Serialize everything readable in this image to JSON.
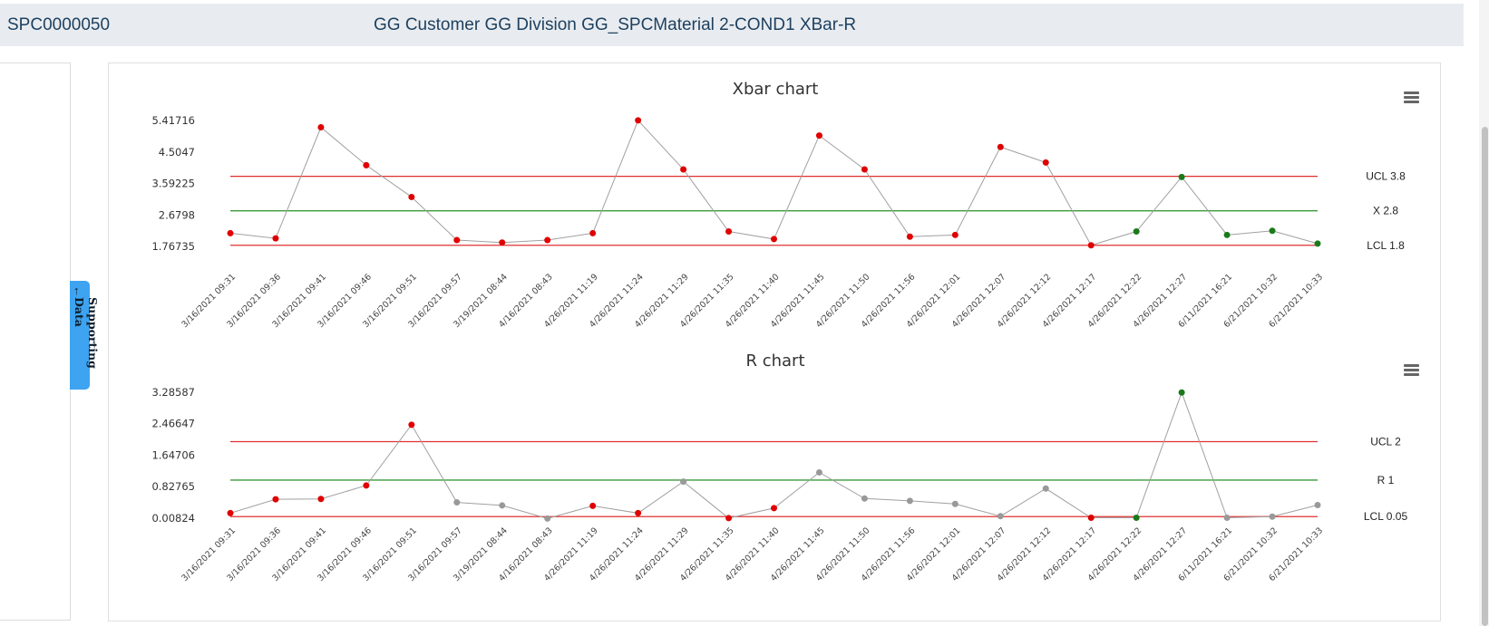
{
  "header": {
    "code": "SPC0000050",
    "title": "GG Customer GG Division GG_SPCMaterial 2-COND1 XBar-R"
  },
  "side_tab": {
    "icon": "arrow-icon",
    "label": "Supporting Data"
  },
  "colors": {
    "limit": "#e03030",
    "center": "#3c9a3c",
    "series_line": "#a0a0a0",
    "point_out": "#e00000",
    "point_in": "#1a7a1a",
    "point_neutral": "#999999",
    "header_bg": "#e8ecf0",
    "header_text": "#1d3f5e",
    "tab_bg": "#3ea3f0"
  },
  "chart_data": [
    {
      "type": "line",
      "title": "Xbar chart",
      "x": [
        "3/16/2021 09:31",
        "3/16/2021 09:36",
        "3/16/2021 09:41",
        "3/16/2021 09:46",
        "3/16/2021 09:51",
        "3/16/2021 09:57",
        "3/19/2021 08:44",
        "4/16/2021 08:43",
        "4/26/2021 11:19",
        "4/26/2021 11:24",
        "4/26/2021 11:29",
        "4/26/2021 11:35",
        "4/26/2021 11:40",
        "4/26/2021 11:45",
        "4/26/2021 11:50",
        "4/26/2021 11:56",
        "4/26/2021 12:01",
        "4/26/2021 12:07",
        "4/26/2021 12:12",
        "4/26/2021 12:17",
        "4/26/2021 12:22",
        "4/26/2021 12:27",
        "6/11/2021 16:21",
        "6/21/2021 10:32",
        "6/21/2021 10:33"
      ],
      "values": [
        2.15,
        2.0,
        5.22,
        4.12,
        3.2,
        1.95,
        1.88,
        1.95,
        2.15,
        5.42,
        4.0,
        2.2,
        1.98,
        4.98,
        4.0,
        2.05,
        2.1,
        4.65,
        4.2,
        1.8,
        2.2,
        3.78,
        2.1,
        2.22,
        1.85
      ],
      "point_status": [
        "out",
        "out",
        "out",
        "out",
        "out",
        "out",
        "out",
        "out",
        "out",
        "out",
        "out",
        "out",
        "out",
        "out",
        "out",
        "out",
        "out",
        "out",
        "out",
        "out",
        "in",
        "in",
        "in",
        "in",
        "in"
      ],
      "yticks": [
        "5.41716",
        "4.5047",
        "3.59225",
        "2.6798",
        "1.76735"
      ],
      "ytick_values": [
        5.41716,
        4.5047,
        3.59225,
        2.6798,
        1.76735
      ],
      "ylim": [
        1.76735,
        5.41716
      ],
      "limits": {
        "ucl": 3.8,
        "center": 2.8,
        "lcl": 1.8
      },
      "limit_labels": {
        "ucl": "UCL 3.8",
        "center": "X 2.8",
        "lcl": "LCL 1.8"
      },
      "xlabel": "",
      "ylabel": "",
      "legend": "none",
      "grid": false
    },
    {
      "type": "line",
      "title": "R chart",
      "x": [
        "3/16/2021 09:31",
        "3/16/2021 09:36",
        "3/16/2021 09:41",
        "3/16/2021 09:46",
        "3/16/2021 09:51",
        "3/16/2021 09:57",
        "3/19/2021 08:44",
        "4/16/2021 08:43",
        "4/26/2021 11:19",
        "4/26/2021 11:24",
        "4/26/2021 11:29",
        "4/26/2021 11:35",
        "4/26/2021 11:40",
        "4/26/2021 11:45",
        "4/26/2021 11:50",
        "4/26/2021 11:56",
        "4/26/2021 12:01",
        "4/26/2021 12:07",
        "4/26/2021 12:12",
        "4/26/2021 12:17",
        "4/26/2021 12:22",
        "4/26/2021 12:27",
        "6/11/2021 16:21",
        "6/21/2021 10:32",
        "6/21/2021 10:33"
      ],
      "values": [
        0.14,
        0.5,
        0.51,
        0.86,
        2.44,
        0.42,
        0.34,
        0.0,
        0.33,
        0.14,
        0.96,
        0.01,
        0.27,
        1.2,
        0.52,
        0.46,
        0.38,
        0.06,
        0.78,
        0.02,
        0.02,
        3.28,
        0.02,
        0.05,
        0.35
      ],
      "point_status": [
        "out",
        "out",
        "out",
        "out",
        "out",
        "neutral",
        "neutral",
        "neutral",
        "out",
        "out",
        "neutral",
        "out",
        "out",
        "neutral",
        "neutral",
        "neutral",
        "neutral",
        "neutral",
        "neutral",
        "out",
        "in",
        "in",
        "neutral",
        "neutral",
        "neutral"
      ],
      "yticks": [
        "3.28587",
        "2.46647",
        "1.64706",
        "0.82765",
        "0.00824"
      ],
      "ytick_values": [
        3.28587,
        2.46647,
        1.64706,
        0.82765,
        0.00824
      ],
      "ylim": [
        0.00824,
        3.28587
      ],
      "limits": {
        "ucl": 2,
        "center": 1,
        "lcl": 0.05
      },
      "limit_labels": {
        "ucl": "UCL 2",
        "center": "R 1",
        "lcl": "LCL 0.05"
      },
      "xlabel": "",
      "ylabel": "",
      "legend": "none",
      "grid": false
    }
  ]
}
